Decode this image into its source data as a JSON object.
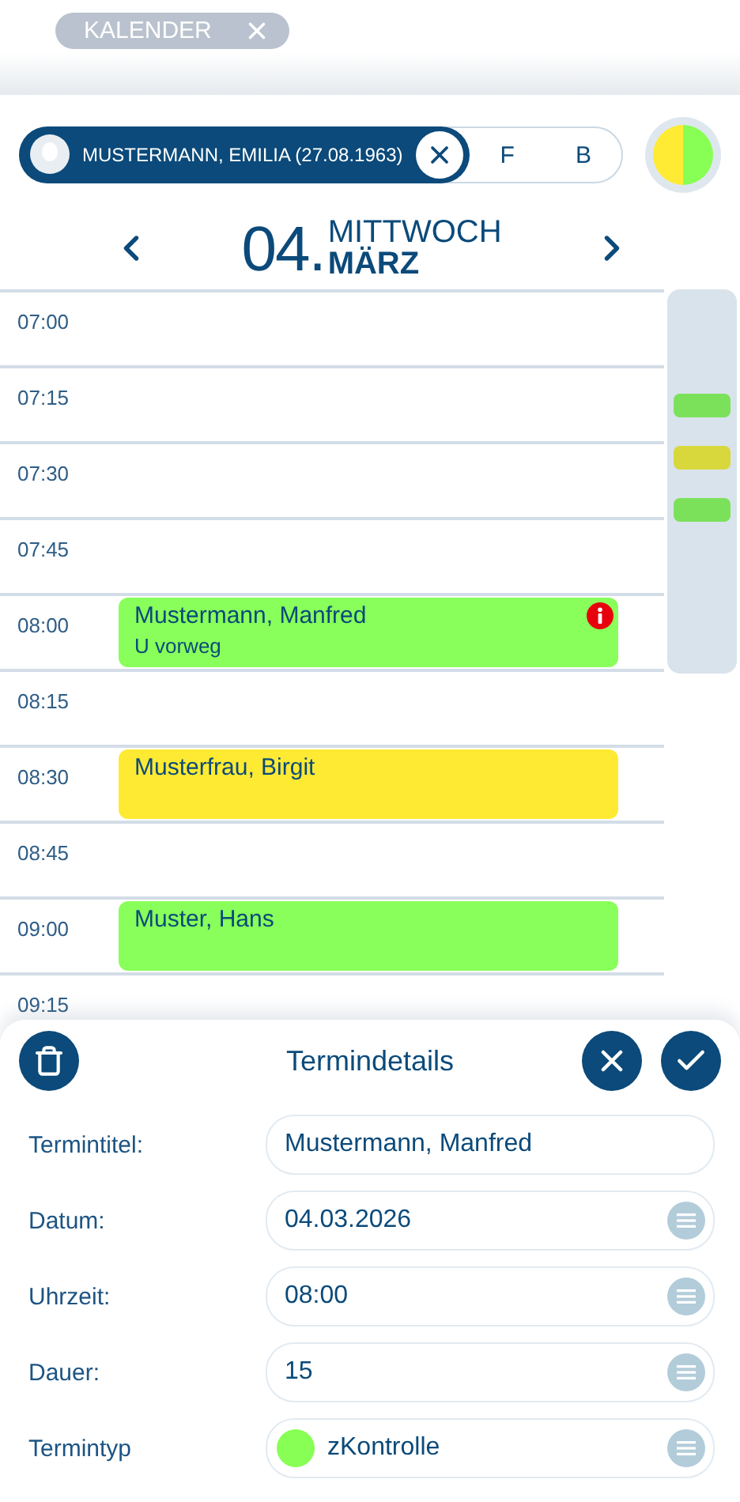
{
  "tab": {
    "label": "KALENDER"
  },
  "patient": {
    "name": "MUSTERMANN, EMILIA (27.08.1963)",
    "options": [
      "F",
      "B"
    ]
  },
  "status_halves": [
    {
      "color": "#ffeb33"
    },
    {
      "color": "#88ff55"
    }
  ],
  "date": {
    "day": "04.",
    "weekday": "MITTWOCH",
    "month": "MÄRZ"
  },
  "slots": [
    {
      "time": "07:00"
    },
    {
      "time": "07:15"
    },
    {
      "time": "07:30"
    },
    {
      "time": "07:45"
    },
    {
      "time": "08:00",
      "event": {
        "title": "Mustermann, Manfred",
        "note": "U vorweg",
        "color": "#88ff5a",
        "info": true
      }
    },
    {
      "time": "08:15"
    },
    {
      "time": "08:30",
      "event": {
        "title": "Musterfrau, Birgit",
        "color": "#ffea33",
        "info": false
      }
    },
    {
      "time": "08:45"
    },
    {
      "time": "09:00",
      "event": {
        "title": "Muster, Hans",
        "color": "#88ff5a",
        "info": false
      }
    },
    {
      "time": "09:15"
    }
  ],
  "overview_markers": [
    {
      "color": "#7ce15a"
    },
    {
      "color": "#d8d83c"
    },
    {
      "color": "#7ce15a"
    }
  ],
  "details": {
    "title": "Termindetails",
    "fields": [
      {
        "label": "Termintitel:",
        "value": "Mustermann, Manfred",
        "kind": "text"
      },
      {
        "label": "Datum:",
        "value": "04.03.2026",
        "kind": "picker"
      },
      {
        "label": "Uhrzeit:",
        "value": "08:00",
        "kind": "picker"
      },
      {
        "label": "Dauer:",
        "value": "15",
        "kind": "picker"
      },
      {
        "label": "Termintyp",
        "value": "zKontrolle",
        "kind": "picker",
        "color": "#88ff55"
      }
    ]
  }
}
